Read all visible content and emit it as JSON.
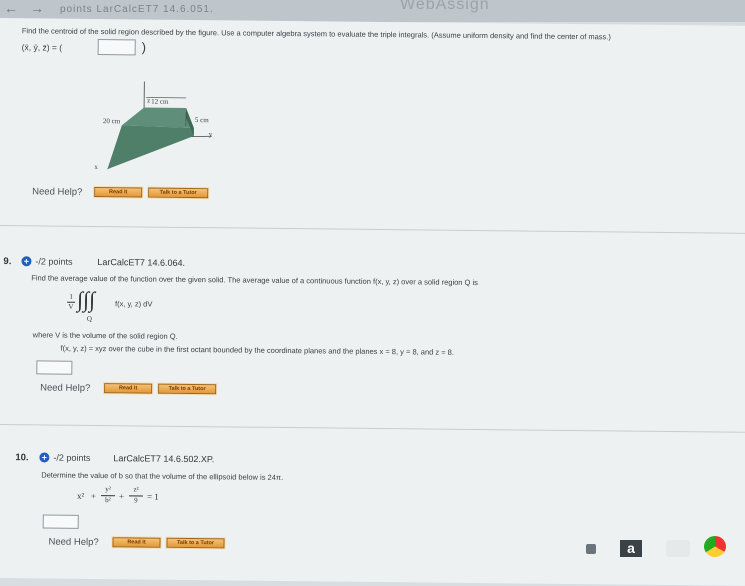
{
  "browser": {
    "brand": "WebAssign",
    "header_fragment": "points   LarCalcET7 14.6.051."
  },
  "q8": {
    "prompt": "Find the centroid of the solid region described by the figure. Use a computer algebra system to evaluate the triple integrals. (Assume uniform density and find the center of mass.)",
    "answer_label": "(x̄, ȳ, z̄) = (",
    "answer_close": ")",
    "figure": {
      "top_label": "12 cm",
      "left_label": "20 cm",
      "right_label": "5 cm",
      "z": "z",
      "y": "y",
      "x": "x"
    },
    "need_help": "Need Help?",
    "read_it": "Read It",
    "talk": "Talk to a Tutor"
  },
  "q9": {
    "number": "9.",
    "points": "-/2 points",
    "code": "LarCalcET7 14.6.064.",
    "prompt": "Find the average value of the function over the given solid. The average value of a continuous function f(x, y, z) over a solid region Q is",
    "frac_num": "1",
    "frac_den": "V",
    "integrand": "f(x, y, z) dV",
    "region": "Q",
    "where": "where V is the volume of the solid region Q.",
    "function_line": "f(x, y, z) = xyz over the cube in the first octant bounded by the coordinate planes and the planes x = 8, y = 8, and z = 8.",
    "need_help": "Need Help?",
    "read_it": "Read It",
    "talk": "Talk to a Tutor"
  },
  "q10": {
    "number": "10.",
    "points": "-/2 points",
    "code": "LarCalcET7 14.6.502.XP.",
    "prompt": "Determine the value of b so that the volume of the ellipsoid below is 24π.",
    "eq_x": "x²",
    "eq_y_num": "y²",
    "eq_y_den": "b²",
    "eq_z_num": "z²",
    "eq_z_den": "9",
    "eq_rhs": "= 1",
    "need_help": "Need Help?",
    "read_it": "Read It",
    "talk": "Talk to a Tutor"
  },
  "tray": {
    "letter": "a"
  }
}
